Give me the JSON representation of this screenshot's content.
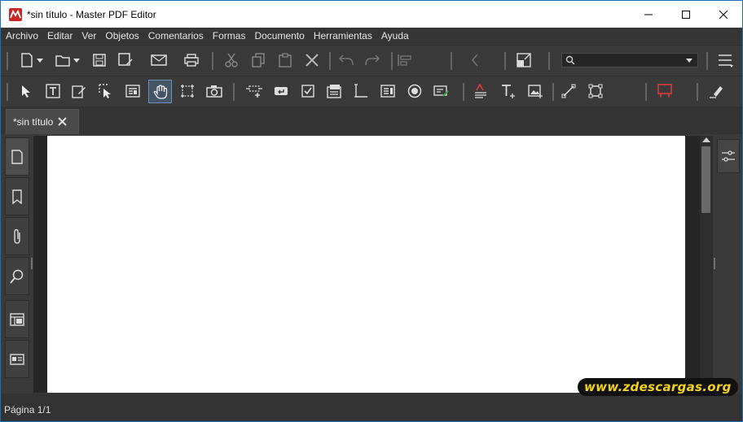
{
  "window": {
    "title": "*sin título - Master PDF Editor",
    "icon": "master-pdf-logo-icon",
    "controls": [
      "minimize-icon",
      "maximize-icon",
      "close-icon"
    ]
  },
  "menu": [
    "Archivo",
    "Editar",
    "Ver",
    "Objetos",
    "Comentarios",
    "Formas",
    "Documento",
    "Herramientas",
    "Ayuda"
  ],
  "toolbar1": {
    "icons": [
      "new-document-icon",
      "open-folder-icon",
      "save-icon",
      "save-as-icon",
      "email-icon",
      "print-icon",
      "cut-icon",
      "copy-icon",
      "paste-icon",
      "delete-icon",
      "undo-icon",
      "redo-icon",
      "align-icon",
      "previous-page-icon",
      "thumbnails-icon",
      "search-icon",
      "menu-icon"
    ],
    "search": {
      "placeholder": "",
      "value": ""
    }
  },
  "toolbar2": {
    "icons": [
      "select-arrow-icon",
      "edit-text-icon",
      "edit-forms-icon",
      "select-object-icon",
      "form-list-icon",
      "hand-icon",
      "crop-select-icon",
      "snapshot-camera-icon",
      "link-icon",
      "button-field-icon",
      "checkbox-field-icon",
      "combo-box-icon",
      "text-field-icon",
      "list-box-icon",
      "radio-button-icon",
      "signature-field-icon",
      "text-highlight-icon",
      "add-text-icon",
      "add-image-icon",
      "line-tool-icon",
      "rectangle-tool-icon",
      "red-comment-box-icon",
      "eraser-icon"
    ],
    "active": "hand-icon"
  },
  "tabs": [
    {
      "label": "*sin título",
      "close_icon": "close-x-icon"
    }
  ],
  "left_sidebar": [
    "pages-icon",
    "bookmarks-icon",
    "attachments-icon",
    "search-panel-icon",
    "layers-icon",
    "signatures-icon"
  ],
  "right_sidebar": [
    "properties-sliders-icon"
  ],
  "status": {
    "page_text": "Página 1/1"
  },
  "watermark": "www.zdescargas.org",
  "colors": {
    "background": "#3a3a3a",
    "accent": "#c62828",
    "watermark": "#f2d21b"
  }
}
